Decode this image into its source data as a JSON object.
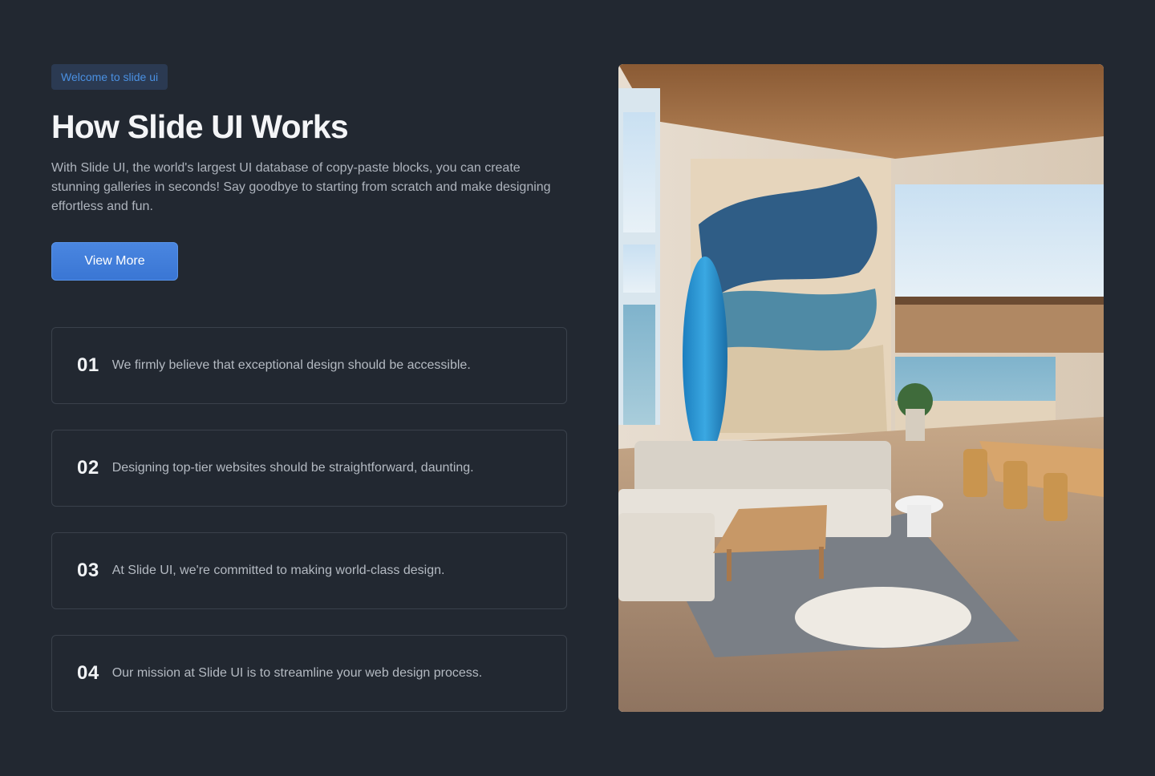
{
  "hero": {
    "badge": "Welcome to slide ui",
    "title": "How Slide UI Works",
    "description": "With Slide UI, the world's largest UI database of copy-paste blocks, you can create stunning galleries in seconds! Say goodbye to starting from scratch and make designing effortless and fun.",
    "cta_label": "View More"
  },
  "features": [
    {
      "number": "01",
      "text": "We firmly believe that exceptional design should be accessible."
    },
    {
      "number": "02",
      "text": "Designing top-tier websites should be straightforward, daunting."
    },
    {
      "number": "03",
      "text": "At Slide UI, we're committed to making world-class design."
    },
    {
      "number": "04",
      "text": "Our mission at Slide UI is to streamline your web design process."
    }
  ],
  "colors": {
    "background": "#222831",
    "accent": "#3a76d4",
    "badge_text": "#4a90e2"
  },
  "image": {
    "description_icon": "interior-photo"
  }
}
